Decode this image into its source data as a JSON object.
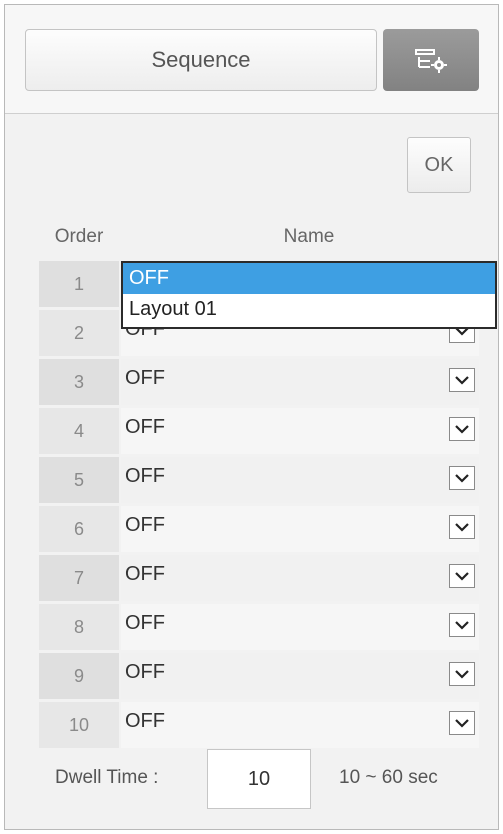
{
  "header": {
    "sequence_label": "Sequence",
    "settings_icon": "layout-settings-icon"
  },
  "toolbar": {
    "ok_label": "OK"
  },
  "table": {
    "columns": [
      "Order",
      "Name"
    ],
    "rows": [
      {
        "order": "1",
        "name": "OFF"
      },
      {
        "order": "2",
        "name": "OFF"
      },
      {
        "order": "3",
        "name": "OFF"
      },
      {
        "order": "4",
        "name": "OFF"
      },
      {
        "order": "5",
        "name": "OFF"
      },
      {
        "order": "6",
        "name": "OFF"
      },
      {
        "order": "7",
        "name": "OFF"
      },
      {
        "order": "8",
        "name": "OFF"
      },
      {
        "order": "9",
        "name": "OFF"
      },
      {
        "order": "10",
        "name": "OFF"
      }
    ]
  },
  "dropdown": {
    "options": [
      "OFF",
      "Layout 01"
    ],
    "selected": "OFF"
  },
  "dwell": {
    "label": "Dwell Time :",
    "value": "10",
    "range": "10 ~ 60 sec"
  },
  "colors": {
    "selection_highlight": "#3e9fe3",
    "settings_button": "#8e8e8e"
  }
}
